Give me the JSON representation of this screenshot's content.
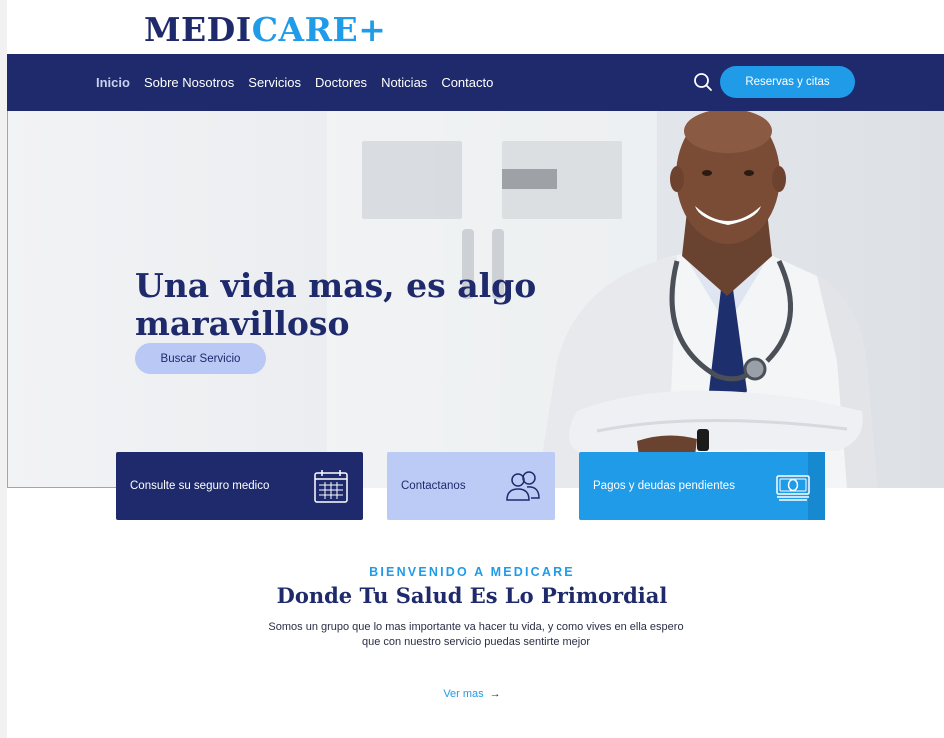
{
  "brand": {
    "logo_part1": "MEDI",
    "logo_part2": "CARE+",
    "color_primary": "#1e2a6b",
    "color_accent": "#1f9be8"
  },
  "nav": {
    "items": [
      {
        "label": "Inicio",
        "active": true
      },
      {
        "label": "Sobre Nosotros"
      },
      {
        "label": "Servicios"
      },
      {
        "label": "Doctores"
      },
      {
        "label": "Noticias"
      },
      {
        "label": "Contacto"
      }
    ],
    "search_icon": "search-icon",
    "cta_label": "Reservas y citas"
  },
  "hero": {
    "title": "Una vida mas, es algo maravilloso",
    "button_label": "Buscar Servicio"
  },
  "cards": [
    {
      "label": "Consulte su seguro medico",
      "icon": "calendar-icon"
    },
    {
      "label": "Contactanos",
      "icon": "users-icon"
    },
    {
      "label": "Pagos y deudas pendientes",
      "icon": "cash-icon"
    }
  ],
  "welcome": {
    "eyebrow": "BIENVENIDO A MEDICARE",
    "title": "Donde Tu Salud Es Lo Primordial",
    "text": "Somos un grupo que lo mas importante va hacer tu vida, y como vives en ella espero que con nuestro servicio puedas sentirte mejor",
    "more_label": "Ver mas"
  }
}
